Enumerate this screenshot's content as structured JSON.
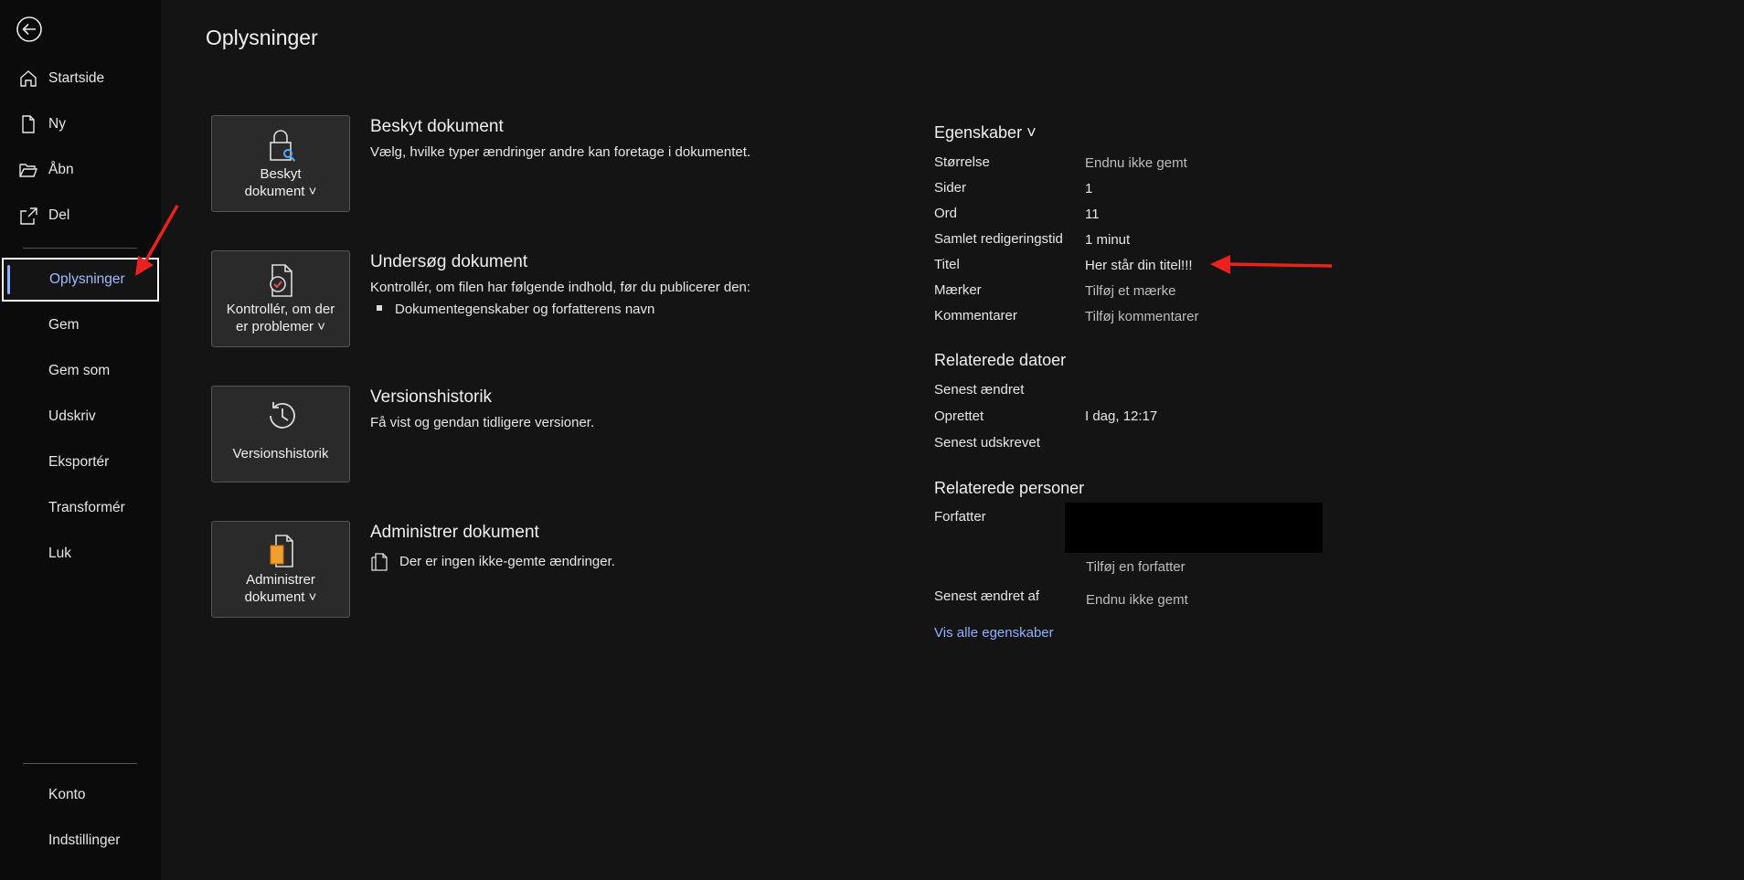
{
  "sidebar": {
    "items": [
      {
        "label": "Startside",
        "icon": "home-icon"
      },
      {
        "label": "Ny",
        "icon": "new-document-icon"
      },
      {
        "label": "Åbn",
        "icon": "open-folder-icon"
      },
      {
        "label": "Del",
        "icon": "share-icon"
      },
      {
        "label": "Oplysninger",
        "active": true
      },
      {
        "label": "Gem"
      },
      {
        "label": "Gem som"
      },
      {
        "label": "Udskriv"
      },
      {
        "label": "Eksportér"
      },
      {
        "label": "Transformér"
      },
      {
        "label": "Luk"
      }
    ],
    "bottom_items": [
      {
        "label": "Konto"
      },
      {
        "label": "Indstillinger"
      }
    ]
  },
  "main": {
    "title": "Oplysninger",
    "sections": [
      {
        "tile_line1": "Beskyt",
        "tile_line2": "dokument ˅",
        "title": "Beskyt dokument",
        "desc": "Vælg, hvilke typer ændringer andre kan foretage i dokumentet."
      },
      {
        "tile_line1": "Kontrollér, om der",
        "tile_line2": "er problemer ˅",
        "title": "Undersøg dokument",
        "desc": "Kontrollér, om filen har følgende indhold, før du publicerer den:",
        "bullet": "Dokumentegenskaber og forfatterens navn"
      },
      {
        "tile_line1": "Versionshistorik",
        "title": "Versionshistorik",
        "desc": "Få vist og gendan tidligere versioner."
      },
      {
        "tile_line1": "Administrer",
        "tile_line2": "dokument ˅",
        "title": "Administrer dokument",
        "desc": "Der er ingen ikke-gemte ændringer."
      }
    ]
  },
  "properties": {
    "heading": "Egenskaber ˅",
    "rows": [
      {
        "label": "Størrelse",
        "value": "Endnu ikke gemt"
      },
      {
        "label": "Sider",
        "value": "1"
      },
      {
        "label": "Ord",
        "value": "11"
      },
      {
        "label": "Samlet redigeringstid",
        "value": "1 minut"
      },
      {
        "label": "Titel",
        "value": "Her står din titel!!!"
      },
      {
        "label": "Mærker",
        "value": "Tilføj et mærke"
      },
      {
        "label": "Kommentarer",
        "value": "Tilføj kommentarer"
      }
    ],
    "dates_heading": "Relaterede datoer",
    "dates": [
      {
        "label": "Senest ændret",
        "value": ""
      },
      {
        "label": "Oprettet",
        "value": "I dag, 12:17"
      },
      {
        "label": "Senest udskrevet",
        "value": ""
      }
    ],
    "people_heading": "Relaterede personer",
    "author_label": "Forfatter",
    "add_author": "Tilføj en forfatter",
    "last_modified_by_label": "Senest ændret af",
    "last_modified_by_value": "Endnu ikke gemt",
    "show_all": "Vis alle egenskaber"
  },
  "colors": {
    "accent": "#8fb0ff",
    "annotation": "#e8231f",
    "background": "#141414",
    "sidebar": "#0b0b0b"
  }
}
